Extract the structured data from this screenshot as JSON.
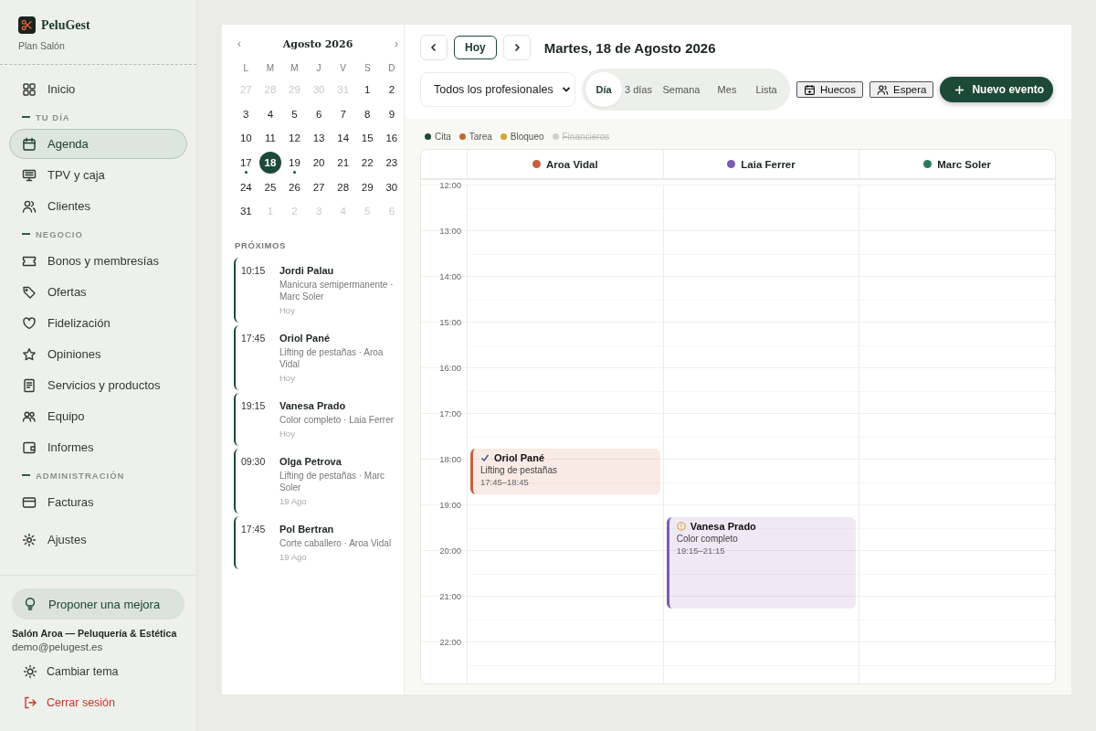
{
  "brand": {
    "name": "PeluGest",
    "plan": "Plan Salón"
  },
  "nav": [
    {
      "kind": "item",
      "label": "Inicio",
      "selected": false
    },
    {
      "kind": "heading",
      "label": "TU DÍA"
    },
    {
      "kind": "item",
      "label": "Agenda",
      "selected": true
    },
    {
      "kind": "item",
      "label": "TPV y caja",
      "selected": false
    },
    {
      "kind": "item",
      "label": "Clientes",
      "selected": false
    },
    {
      "kind": "heading",
      "label": "NEGOCIO"
    },
    {
      "kind": "item",
      "label": "Bonos y membresías",
      "selected": false
    },
    {
      "kind": "item",
      "label": "Ofertas",
      "selected": false
    },
    {
      "kind": "item",
      "label": "Fidelización",
      "selected": false
    },
    {
      "kind": "item",
      "label": "Opiniones",
      "selected": false
    },
    {
      "kind": "item",
      "label": "Servicios y productos",
      "selected": false
    },
    {
      "kind": "item",
      "label": "Equipo",
      "selected": false
    },
    {
      "kind": "item",
      "label": "Informes",
      "selected": false
    },
    {
      "kind": "heading",
      "label": "ADMINISTRACIÓN"
    },
    {
      "kind": "item",
      "label": "Facturas",
      "selected": false
    },
    {
      "kind": "item",
      "label": "Ajustes",
      "selected": false
    }
  ],
  "suggest_button": "Proponer una mejora",
  "account": {
    "name": "Salón Aroa — Peluquería & Estética",
    "email": "demo@pelugest.es"
  },
  "theme_button": "Cambiar tema",
  "logout_button": "Cerrar sesión",
  "mini_calendar": {
    "title": "Agosto 2026",
    "prev": "‹",
    "next": "›",
    "weekdays": [
      "L",
      "M",
      "M",
      "J",
      "V",
      "S",
      "D"
    ],
    "days": [
      {
        "label": "27",
        "muted": true,
        "selected": false,
        "has_events": false
      },
      {
        "label": "28",
        "muted": true,
        "selected": false,
        "has_events": false
      },
      {
        "label": "29",
        "muted": true,
        "selected": false,
        "has_events": false
      },
      {
        "label": "30",
        "muted": true,
        "selected": false,
        "has_events": false
      },
      {
        "label": "31",
        "muted": true,
        "selected": false,
        "has_events": false
      },
      {
        "label": "1",
        "muted": false,
        "selected": false,
        "has_events": false
      },
      {
        "label": "2",
        "muted": false,
        "selected": false,
        "has_events": false
      },
      {
        "label": "3",
        "muted": false,
        "selected": false,
        "has_events": false
      },
      {
        "label": "4",
        "muted": false,
        "selected": false,
        "has_events": false
      },
      {
        "label": "5",
        "muted": false,
        "selected": false,
        "has_events": false
      },
      {
        "label": "6",
        "muted": false,
        "selected": false,
        "has_events": false
      },
      {
        "label": "7",
        "muted": false,
        "selected": false,
        "has_events": false
      },
      {
        "label": "8",
        "muted": false,
        "selected": false,
        "has_events": false
      },
      {
        "label": "9",
        "muted": false,
        "selected": false,
        "has_events": false
      },
      {
        "label": "10",
        "muted": false,
        "selected": false,
        "has_events": false
      },
      {
        "label": "11",
        "muted": false,
        "selected": false,
        "has_events": false
      },
      {
        "label": "12",
        "muted": false,
        "selected": false,
        "has_events": false
      },
      {
        "label": "13",
        "muted": false,
        "selected": false,
        "has_events": false
      },
      {
        "label": "14",
        "muted": false,
        "selected": false,
        "has_events": false
      },
      {
        "label": "15",
        "muted": false,
        "selected": false,
        "has_events": false
      },
      {
        "label": "16",
        "muted": false,
        "selected": false,
        "has_events": false
      },
      {
        "label": "17",
        "muted": false,
        "selected": false,
        "has_events": true
      },
      {
        "label": "18",
        "muted": false,
        "selected": true,
        "has_events": false
      },
      {
        "label": "19",
        "muted": false,
        "selected": false,
        "has_events": true
      },
      {
        "label": "20",
        "muted": false,
        "selected": false,
        "has_events": false
      },
      {
        "label": "21",
        "muted": false,
        "selected": false,
        "has_events": false
      },
      {
        "label": "22",
        "muted": false,
        "selected": false,
        "has_events": false
      },
      {
        "label": "23",
        "muted": false,
        "selected": false,
        "has_events": false
      },
      {
        "label": "24",
        "muted": false,
        "selected": false,
        "has_events": false
      },
      {
        "label": "25",
        "muted": false,
        "selected": false,
        "has_events": false
      },
      {
        "label": "26",
        "muted": false,
        "selected": false,
        "has_events": false
      },
      {
        "label": "27",
        "muted": false,
        "selected": false,
        "has_events": false
      },
      {
        "label": "28",
        "muted": false,
        "selected": false,
        "has_events": false
      },
      {
        "label": "29",
        "muted": false,
        "selected": false,
        "has_events": false
      },
      {
        "label": "30",
        "muted": false,
        "selected": false,
        "has_events": false
      },
      {
        "label": "31",
        "muted": false,
        "selected": false,
        "has_events": false
      },
      {
        "label": "1",
        "muted": true,
        "selected": false,
        "has_events": false
      },
      {
        "label": "2",
        "muted": true,
        "selected": false,
        "has_events": false
      },
      {
        "label": "3",
        "muted": true,
        "selected": false,
        "has_events": false
      },
      {
        "label": "4",
        "muted": true,
        "selected": false,
        "has_events": false
      },
      {
        "label": "5",
        "muted": true,
        "selected": false,
        "has_events": false
      },
      {
        "label": "6",
        "muted": true,
        "selected": false,
        "has_events": false
      }
    ]
  },
  "upcoming": {
    "title": "PRÓXIMOS",
    "items": [
      {
        "time": "10:15",
        "client": "Jordi Palau",
        "detail": "Manicura semipermanente · Marc Soler",
        "day": "Hoy"
      },
      {
        "time": "17:45",
        "client": "Oriol Pané",
        "detail": "Lifting de pestañas · Aroa Vidal",
        "day": "Hoy"
      },
      {
        "time": "19:15",
        "client": "Vanesa Prado",
        "detail": "Color completo · Laia Ferrer",
        "day": "Hoy"
      },
      {
        "time": "09:30",
        "client": "Olga Petrova",
        "detail": "Lifting de pestañas · Marc Soler",
        "day": "19 Ago"
      },
      {
        "time": "17:45",
        "client": "Pol Bertran",
        "detail": "Corte caballero · Aroa Vidal",
        "day": "19 Ago"
      }
    ]
  },
  "toolbar": {
    "today_button": "Hoy",
    "date_title": "Martes, 18 de Agosto 2026",
    "professional_select": "Todos los profesionales",
    "views": [
      {
        "label": "Día",
        "selected": true
      },
      {
        "label": "3 días",
        "selected": false
      },
      {
        "label": "Semana",
        "selected": false
      },
      {
        "label": "Mes",
        "selected": false
      },
      {
        "label": "Lista",
        "selected": false
      }
    ],
    "gaps_button": "Huecos",
    "waitlist_button": "Espera",
    "new_event_button": "Nuevo evento"
  },
  "legend": [
    {
      "label": "Cita",
      "color": "#1d4a38",
      "hidden": false
    },
    {
      "label": "Tarea",
      "color": "#c06a2b",
      "hidden": false
    },
    {
      "label": "Bloqueo",
      "color": "#d4a72c",
      "hidden": false
    },
    {
      "label": "Financieros",
      "color": "#cfcfcb",
      "hidden": true
    }
  ],
  "schedule": {
    "hours": [
      "12:00",
      "13:00",
      "14:00",
      "15:00",
      "16:00",
      "17:00",
      "18:00",
      "19:00",
      "20:00",
      "21:00",
      "22:00"
    ],
    "columns": [
      {
        "name": "Aroa Vidal",
        "color": "#c8603e",
        "events": [
          {
            "kind": "confirmed",
            "client": "Oriol Pané",
            "service": "Lifting de pestañas",
            "time": "17:45–18:45"
          }
        ]
      },
      {
        "name": "Laia Ferrer",
        "color": "#7c5cac",
        "events": [
          {
            "kind": "pending",
            "client": "Vanesa Prado",
            "service": "Color completo",
            "time": "19:15–21:15"
          }
        ]
      },
      {
        "name": "Marc Soler",
        "color": "#2c7a5d"
      }
    ]
  }
}
